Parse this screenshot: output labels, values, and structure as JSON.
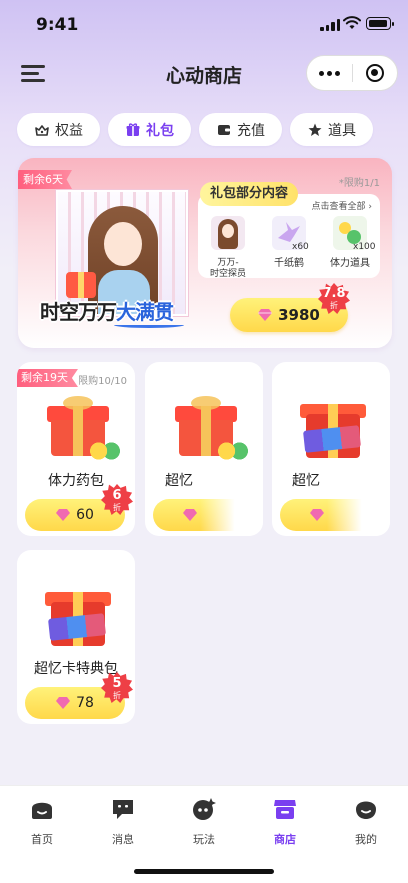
{
  "status_bar": {
    "time": "9:41"
  },
  "header": {
    "title": "心动商店"
  },
  "tabs": [
    {
      "label": "权益",
      "icon": "crown-box-icon"
    },
    {
      "label": "礼包",
      "icon": "gift-icon",
      "active": true
    },
    {
      "label": "充值",
      "icon": "wallet-icon"
    },
    {
      "label": "道具",
      "icon": "star-prop-icon"
    }
  ],
  "featured": {
    "days_left": "剩余6天",
    "limit": "*限购1/1",
    "art_title_dark": "时空万万",
    "art_title_blue": "大满贯",
    "contents_title": "礼包部分内容",
    "view_all": "点击查看全部 ›",
    "items": [
      {
        "name": "万万-\n时空探员",
        "count": ""
      },
      {
        "name": "千纸鹤",
        "count": "x60"
      },
      {
        "name": "体力道具",
        "count": "x100"
      }
    ],
    "price": "3980",
    "discount_num": "7.8",
    "discount_unit": "折"
  },
  "cards": [
    {
      "name": "体力药包",
      "price": "60",
      "days_left": "剩余19天",
      "limit": "限购10/10",
      "discount_num": "6",
      "discount_unit": "折"
    },
    {
      "name": "超忆",
      "price": ""
    },
    {
      "name": "超忆",
      "price": ""
    },
    {
      "name": "超忆卡特典包",
      "price": "78",
      "discount_num": "5",
      "discount_unit": "折"
    }
  ],
  "tabbar": [
    {
      "label": "首页",
      "icon": "home-icon"
    },
    {
      "label": "消息",
      "icon": "message-icon"
    },
    {
      "label": "玩法",
      "icon": "planet-icon"
    },
    {
      "label": "商店",
      "icon": "shop-icon",
      "active": true
    },
    {
      "label": "我的",
      "icon": "profile-icon"
    }
  ],
  "colors": {
    "accent": "#7a3ff0",
    "price_yellow": "#ffd84a",
    "discount_red": "#ee3f46",
    "tag_pink": "#ff5f7e"
  }
}
